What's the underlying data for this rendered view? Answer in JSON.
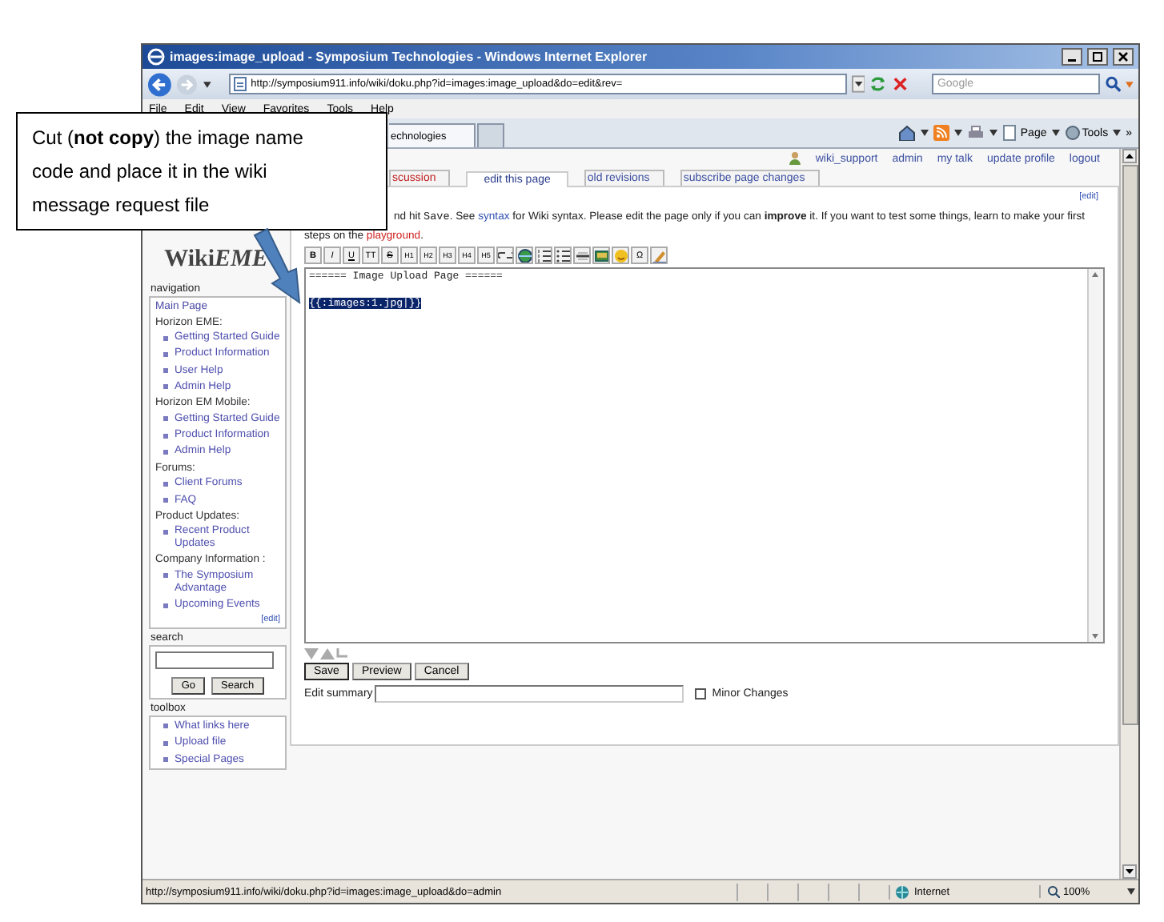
{
  "window": {
    "title": "images:image_upload - Symposium Technologies - Windows Internet Explorer"
  },
  "address_bar": {
    "url": "http://symposium911.info/wiki/doku.php?id=images:image_upload&do=edit&rev="
  },
  "search_box": {
    "placeholder": "Google"
  },
  "menu": [
    "File",
    "Edit",
    "View",
    "Favorites",
    "Tools",
    "Help"
  ],
  "browser_tab": {
    "label": "echnologies"
  },
  "command_bar": {
    "items": [
      "Page",
      "Tools"
    ],
    "overflow": "»"
  },
  "user_links": [
    "wiki_support",
    "admin",
    "my talk",
    "update profile",
    "logout"
  ],
  "page_tabs": [
    {
      "label": "scussion",
      "selected": false,
      "missing": true
    },
    {
      "label": "edit this page",
      "selected": true,
      "missing": false
    },
    {
      "label": "old revisions",
      "selected": false,
      "missing": false
    },
    {
      "label": "subscribe page changes",
      "selected": false,
      "missing": false
    }
  ],
  "edit_link": "[edit]",
  "intro": [
    {
      "kind": "text",
      "text": "nd hit "
    },
    {
      "kind": "code",
      "text": "Save"
    },
    {
      "kind": "text",
      "text": ". See "
    },
    {
      "kind": "link",
      "text": "syntax"
    },
    {
      "kind": "text",
      "text": " for Wiki syntax. Please edit the page only if you can "
    },
    {
      "kind": "strong",
      "text": "improve"
    },
    {
      "kind": "text",
      "text": " it. If you want to test some things, learn to make your first steps on the "
    },
    {
      "kind": "redlink",
      "text": "playground"
    },
    {
      "kind": "text",
      "text": "."
    }
  ],
  "toolbar": [
    {
      "kind": "text",
      "label": "B"
    },
    {
      "kind": "text",
      "label": "I"
    },
    {
      "kind": "text",
      "label": "U"
    },
    {
      "kind": "text",
      "label": "TT"
    },
    {
      "kind": "text",
      "label": "S"
    },
    {
      "kind": "text",
      "label": "H1"
    },
    {
      "kind": "text",
      "label": "H2"
    },
    {
      "kind": "text",
      "label": "H3"
    },
    {
      "kind": "text",
      "label": "H4"
    },
    {
      "kind": "text",
      "label": "H5"
    },
    {
      "kind": "link"
    },
    {
      "kind": "globe"
    },
    {
      "kind": "olist"
    },
    {
      "kind": "ulist"
    },
    {
      "kind": "rule"
    },
    {
      "kind": "image"
    },
    {
      "kind": "smiley"
    },
    {
      "kind": "text",
      "label": "Ω"
    },
    {
      "kind": "signature"
    }
  ],
  "editor": {
    "lines": [
      {
        "text": "====== Image Upload Page ======",
        "selected": false
      },
      {
        "text": "{{:images:1.jpg|}}",
        "selected": true
      }
    ]
  },
  "buttons": [
    "Save",
    "Preview",
    "Cancel"
  ],
  "edit_summary": {
    "label": "Edit summary"
  },
  "minor_changes": {
    "label": "Minor Changes",
    "checked": false
  },
  "sidebar": {
    "logo": [
      "Wiki",
      "EME"
    ],
    "navigation_title": "navigation",
    "nav": [
      {
        "kind": "link",
        "text": "Main Page"
      },
      {
        "kind": "heading",
        "text": "Horizon EME:"
      },
      {
        "kind": "bullet",
        "text": "Getting Started Guide"
      },
      {
        "kind": "bullet",
        "text": "Product Information"
      },
      {
        "kind": "bullet",
        "text": "User Help"
      },
      {
        "kind": "bullet",
        "text": "Admin Help"
      },
      {
        "kind": "heading",
        "text": "Horizon EM Mobile:"
      },
      {
        "kind": "bullet",
        "text": "Getting Started Guide"
      },
      {
        "kind": "bullet",
        "text": "Product Information"
      },
      {
        "kind": "bullet",
        "text": "Admin Help"
      },
      {
        "kind": "heading",
        "text": "Forums:"
      },
      {
        "kind": "bullet",
        "text": "Client Forums"
      },
      {
        "kind": "bullet",
        "text": "FAQ"
      },
      {
        "kind": "heading",
        "text": "Product Updates:"
      },
      {
        "kind": "bullet",
        "text": "Recent Product Updates"
      },
      {
        "kind": "heading",
        "text": "Company Information :"
      },
      {
        "kind": "bullet",
        "text": "The Symposium Advantage"
      },
      {
        "kind": "bullet",
        "text": "Upcoming Events"
      }
    ],
    "nav_edit": "[edit]",
    "search_title": "search",
    "search_buttons": [
      "Go",
      "Search"
    ],
    "toolbox_title": "toolbox",
    "toolbox": [
      "What links here",
      "Upload file",
      "Special Pages"
    ]
  },
  "status_bar": {
    "text": "http://symposium911.info/wiki/doku.php?id=images:image_upload&do=admin",
    "zone": "Internet",
    "zoom": "100%"
  },
  "callout": {
    "text": "Cut (**not copy**) the image name code and place it in the wiki message request file"
  }
}
